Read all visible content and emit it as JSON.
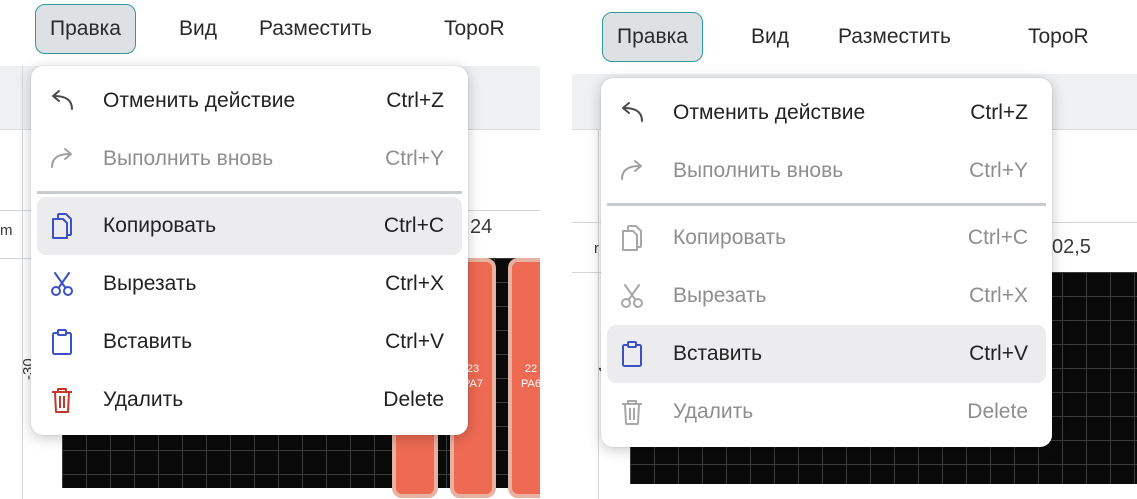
{
  "panels": [
    {
      "menubar": {
        "items": [
          "Правка",
          "Вид",
          "Разместить",
          "TopoR"
        ],
        "active_index": 0
      },
      "canvas": {
        "ruler_top": "24",
        "ruler_side": "-30",
        "ruler_corner": "m",
        "pads": [
          {
            "num": "23",
            "name": "PA7"
          },
          {
            "num": "22",
            "name": "PA6"
          }
        ]
      },
      "menu": {
        "groups": [
          [
            {
              "icon": "undo-icon",
              "label": "Отменить действие",
              "shortcut": "Ctrl+Z",
              "enabled": true
            },
            {
              "icon": "redo-icon",
              "label": "Выполнить вновь",
              "shortcut": "Ctrl+Y",
              "enabled": false
            }
          ],
          [
            {
              "icon": "copy-icon",
              "label": "Копировать",
              "shortcut": "Ctrl+C",
              "enabled": true,
              "hover": true
            },
            {
              "icon": "cut-icon",
              "label": "Вырезать",
              "shortcut": "Ctrl+X",
              "enabled": true
            },
            {
              "icon": "paste-icon",
              "label": "Вставить",
              "shortcut": "Ctrl+V",
              "enabled": true
            },
            {
              "icon": "delete-icon",
              "label": "Удалить",
              "shortcut": "Delete",
              "enabled": true
            }
          ]
        ]
      }
    },
    {
      "menubar": {
        "items": [
          "Правка",
          "Вид",
          "Разместить",
          "TopoR"
        ],
        "active_index": 0
      },
      "canvas": {
        "ruler_top": "02,5",
        "ruler_side": "-1",
        "ruler_corner": "r"
      },
      "menu": {
        "groups": [
          [
            {
              "icon": "undo-icon",
              "label": "Отменить действие",
              "shortcut": "Ctrl+Z",
              "enabled": true
            },
            {
              "icon": "redo-icon",
              "label": "Выполнить вновь",
              "shortcut": "Ctrl+Y",
              "enabled": false
            }
          ],
          [
            {
              "icon": "copy-icon",
              "label": "Копировать",
              "shortcut": "Ctrl+C",
              "enabled": false
            },
            {
              "icon": "cut-icon",
              "label": "Вырезать",
              "shortcut": "Ctrl+X",
              "enabled": false
            },
            {
              "icon": "paste-icon",
              "label": "Вставить",
              "shortcut": "Ctrl+V",
              "enabled": true,
              "hover": true
            },
            {
              "icon": "delete-icon",
              "label": "Удалить",
              "shortcut": "Delete",
              "enabled": false
            }
          ]
        ]
      }
    }
  ],
  "colors": {
    "accent_border": "#2e9aa0",
    "icon_blue": "#3a52c4",
    "icon_red": "#c0392b",
    "disabled": "#8e8e8e",
    "pad_fill": "#ee6a52"
  }
}
